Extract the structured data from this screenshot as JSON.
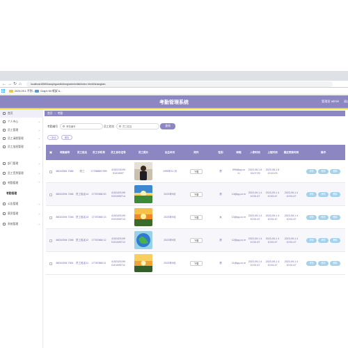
{
  "browser": {
    "url": "localhost:8080/kaoqinguanlixitong/admin/dist/index.html#/shangban",
    "bookmarks": [
      {
        "label": "2024.09.1 不到..."
      },
      {
        "label": "Graph Kit 框架 &..."
      }
    ]
  },
  "app": {
    "title": "考勤管理系统",
    "user": "管理员 admin",
    "logout": "退出"
  },
  "sidebar": {
    "items": [
      {
        "label": "首页",
        "icon": "home-icon"
      },
      {
        "label": "个人中心",
        "icon": "user-icon"
      },
      {
        "label": "员工管理",
        "icon": "users-icon"
      },
      {
        "label": "员工请假管理",
        "icon": "leave-icon"
      },
      {
        "label": "员工加班管理",
        "icon": "overtime-icon"
      },
      {
        "label": "部门管理",
        "icon": "department-icon"
      },
      {
        "label": "员工签到管理",
        "icon": "checkin-icon"
      },
      {
        "label": "考勤管理",
        "icon": "attendance-icon"
      }
    ],
    "sub_item": "考勤管理",
    "items_after": [
      {
        "label": "公告管理",
        "icon": "notice-icon"
      },
      {
        "label": "薪资管理",
        "icon": "salary-icon"
      },
      {
        "label": "系统管理",
        "icon": "settings-icon"
      }
    ]
  },
  "breadcrumb": {
    "home": "首页",
    "current": "考勤"
  },
  "search": {
    "label1": "考勤编号",
    "placeholder1": "考勤编号",
    "label2": "员工姓名",
    "placeholder2": "员工姓名",
    "button": "查询"
  },
  "actions": {
    "add": "+ 新增",
    "delete": "删除"
  },
  "table": {
    "headers": [
      "",
      "考勤编号",
      "员工姓名",
      "员工手机号",
      "员工身份证号",
      "员工照片",
      "出生年月",
      "附件",
      "性别",
      "邮箱",
      "入职时间",
      "上班时间",
      "最近更新时间",
      "操作"
    ],
    "rows": [
      {
        "id": "86010084 7086",
        "name": "张三",
        "phone": "17788889 999",
        "idcard": "4152215199 01010007",
        "photo": "person",
        "birth": "1990年11 月",
        "attach": "下载",
        "gender": "男",
        "email": "999@qq.co m",
        "hire": "2023-08-1 8 15:07:09",
        "start": "2023-08-1 8 13:10:23",
        "update": "",
        "ops": [
          "详情",
          "修改",
          "删除"
        ]
      },
      {
        "id": "86010094 7286",
        "name": "员工姓名14",
        "phone": "17787868 00",
        "idcard": "4152420199 0101005714",
        "photo": "landscape",
        "birth": "2023年9月",
        "attach": "下载",
        "gender": "男",
        "email": "14@qq.co m",
        "hire": "2023-09-1 4 10:51:47",
        "start": "2023-09-1 4 10:51:47",
        "update": "2023-09-1 4 10:51:47",
        "ops": [
          "详情",
          "修改",
          "删除"
        ]
      },
      {
        "id": "86010094 7246",
        "name": "员工姓名13",
        "phone": "17787868 13",
        "idcard": "4152420199 0101005713",
        "photo": "sunset",
        "birth": "2023年9月",
        "attach": "下载",
        "gender": "女",
        "email": "13@qq.co m",
        "hire": "2023-09-1 4 10:51:47",
        "start": "2023-09-1 4 10:51:47",
        "update": "2023-09-1 4 10:51:47",
        "ops": [
          "详情",
          "修改",
          "删除"
        ]
      },
      {
        "id": "86010094 7286",
        "name": "员工姓名12",
        "phone": "17787868 12",
        "idcard": "4152420199 0101005712",
        "photo": "globe",
        "birth": "2023年9月",
        "attach": "下载",
        "gender": "男",
        "email": "12@qq.co m",
        "hire": "2023-09-1 4 10:51:47",
        "start": "2023-09-1 4 10:51:47",
        "update": "2023-09-1 4 10:51:47",
        "ops": [
          "详情",
          "修改",
          "删除"
        ]
      },
      {
        "id": "86010094 7361",
        "name": "员工姓名11",
        "phone": "17787868 11",
        "idcard": "4152420199 0101005711",
        "photo": "sunset2",
        "birth": "2023年9月",
        "attach": "下载",
        "gender": "男",
        "email": "11@qq.co m",
        "hire": "2023-09-1 4 10:51:47",
        "start": "2023-09-1 4 10:51:47",
        "update": "2023-09-1 4 10:51:47",
        "ops": [
          "详情",
          "修改",
          "删除"
        ]
      }
    ]
  },
  "colors": {
    "primary": "#8c86c2",
    "accent_bar": "#e8d63a",
    "op_button": "#a4d2ec"
  }
}
